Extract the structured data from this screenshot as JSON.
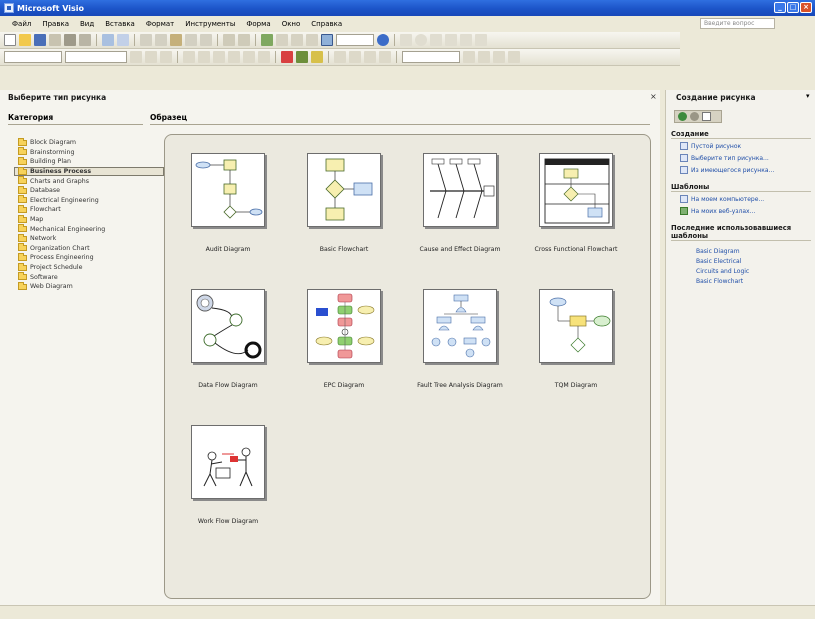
{
  "window": {
    "title": "Microsoft Visio"
  },
  "menu": {
    "items": [
      "Файл",
      "Правка",
      "Вид",
      "Вставка",
      "Формат",
      "Инструменты",
      "Форма",
      "Окно",
      "Справка"
    ],
    "help_placeholder": "Введите вопрос"
  },
  "left_pane": {
    "title": "Выберите тип рисунка",
    "categories_header": "Категория",
    "sample_header": "Образец",
    "categories": [
      "Block Diagram",
      "Brainstorming",
      "Building Plan",
      "Business Process",
      "Charts and Graphs",
      "Database",
      "Electrical Engineering",
      "Flowchart",
      "Map",
      "Mechanical Engineering",
      "Network",
      "Organization Chart",
      "Process Engineering",
      "Project Schedule",
      "Software",
      "Web Diagram"
    ],
    "selected_category": "Business Process",
    "templates": [
      "Audit Diagram",
      "Basic Flowchart",
      "Cause and Effect Diagram",
      "Cross Functional Flowchart",
      "Data Flow Diagram",
      "EPC Diagram",
      "Fault Tree Analysis Diagram",
      "TQM Diagram",
      "Work Flow Diagram"
    ]
  },
  "right_pane": {
    "title": "Создание рисунка",
    "section_create": "Создание",
    "create_links": [
      "Пустой рисунок",
      "Выберите тип рисунка...",
      "Из имеющегося рисунка..."
    ],
    "section_templates": "Шаблоны",
    "template_links": [
      "На моем компьютере...",
      "На моих веб-узлах..."
    ],
    "section_recent": "Последние использовавшиеся шаблоны",
    "recent": [
      "Basic Diagram",
      "Basic Electrical",
      "Circuits and Logic",
      "Basic Flowchart"
    ]
  }
}
